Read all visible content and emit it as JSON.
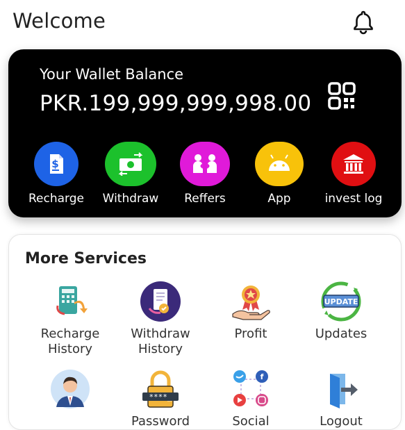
{
  "header": {
    "title": "Welcome",
    "bell_icon": "bell-icon"
  },
  "wallet": {
    "title": "Your Wallet Balance",
    "balance": "PKR.199,999,999,998.00",
    "qr_icon": "qr-code-icon",
    "actions": [
      {
        "label": "Recharge",
        "icon": "invoice-dollar-icon",
        "color": "#1e63e6"
      },
      {
        "label": "Withdraw",
        "icon": "cash-exchange-icon",
        "color": "#1cc12c"
      },
      {
        "label": "Reffers",
        "icon": "referral-people-icon",
        "color": "#e01ad9"
      },
      {
        "label": "App",
        "icon": "android-icon",
        "color": "#f8c20a"
      },
      {
        "label": "invest log",
        "icon": "bank-icon",
        "color": "#e00f12"
      }
    ]
  },
  "services": {
    "title": "More Services",
    "items": [
      {
        "label": "Recharge History",
        "icon": "recharge-history-icon"
      },
      {
        "label": "Withdraw History",
        "icon": "withdraw-history-icon"
      },
      {
        "label": "Profit",
        "icon": "award-hand-icon"
      },
      {
        "label": "Updates",
        "icon": "update-badge-icon"
      },
      {
        "label": "",
        "icon": "user-avatar-icon"
      },
      {
        "label": "Password",
        "icon": "padlock-icon"
      },
      {
        "label": "Social",
        "icon": "social-media-icon"
      },
      {
        "label": "Logout",
        "icon": "logout-icon"
      }
    ]
  }
}
